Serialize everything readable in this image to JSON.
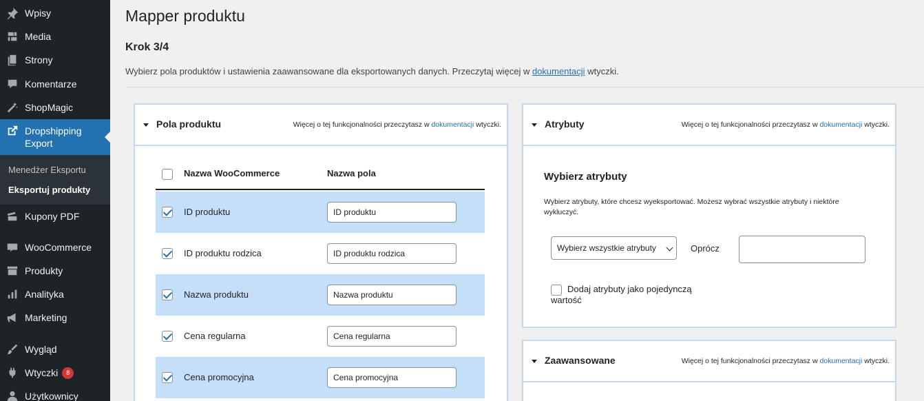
{
  "sidebar": {
    "items": [
      {
        "label": "Wpisy",
        "icon": "pin-icon"
      },
      {
        "label": "Media",
        "icon": "media-icon"
      },
      {
        "label": "Strony",
        "icon": "pages-icon"
      },
      {
        "label": "Komentarze",
        "icon": "comments-icon"
      },
      {
        "label": "ShopMagic",
        "icon": "magic-wand-icon"
      },
      {
        "label": "Dropshipping Export",
        "icon": "external-link-icon"
      },
      {
        "label": "Kupony PDF",
        "icon": "coupons-icon"
      },
      {
        "label": "WooCommerce",
        "icon": "woocommerce-icon"
      },
      {
        "label": "Produkty",
        "icon": "archive-icon"
      },
      {
        "label": "Analityka",
        "icon": "chart-bar-icon"
      },
      {
        "label": "Marketing",
        "icon": "megaphone-icon"
      },
      {
        "label": "Wygląd",
        "icon": "paintbrush-icon"
      },
      {
        "label": "Wtyczki",
        "icon": "plugin-icon",
        "badge": "8"
      },
      {
        "label": "Użytkownicy",
        "icon": "users-icon"
      }
    ],
    "submenu": [
      "Menedżer Eksportu",
      "Eksportuj produkty"
    ]
  },
  "page": {
    "title": "Mapper produktu",
    "step": "Krok 3/4",
    "desc_before": "Wybierz pola produktów i ustawienia zaawansowane dla eksportowanych danych. Przeczytaj więcej w ",
    "desc_link": "dokumentacji",
    "desc_after": " wtyczki."
  },
  "note": {
    "before": "Więcej o tej funkcjonalności przeczytasz w ",
    "link": "dokumentacji",
    "after": " wtyczki."
  },
  "product_fields": {
    "title": "Pola produktu",
    "col_woo": "Nazwa WooCommerce",
    "col_field": "Nazwa pola",
    "rows": [
      {
        "label": "ID produktu",
        "value": "ID produktu",
        "checked": true
      },
      {
        "label": "ID produktu rodzica",
        "value": "ID produktu rodzica",
        "checked": true
      },
      {
        "label": "Nazwa produktu",
        "value": "Nazwa produktu",
        "checked": true
      },
      {
        "label": "Cena regularna",
        "value": "Cena regularna",
        "checked": true
      },
      {
        "label": "Cena promocyjna",
        "value": "Cena promocyjna",
        "checked": true
      }
    ]
  },
  "attributes": {
    "title": "Atrybuty",
    "heading": "Wybierz atrybuty",
    "description": "Wybierz atrybuty, które chcesz wyeksportować. Możesz wybrać wszystkie atrybuty i niektóre wykluczyć.",
    "select_value": "Wybierz wszystkie atrybuty",
    "except_label": "Oprócz",
    "exclude_value": "",
    "single_label": "Dodaj atrybuty jako pojedynczą wartość"
  },
  "advanced": {
    "title": "Zaawansowane"
  }
}
